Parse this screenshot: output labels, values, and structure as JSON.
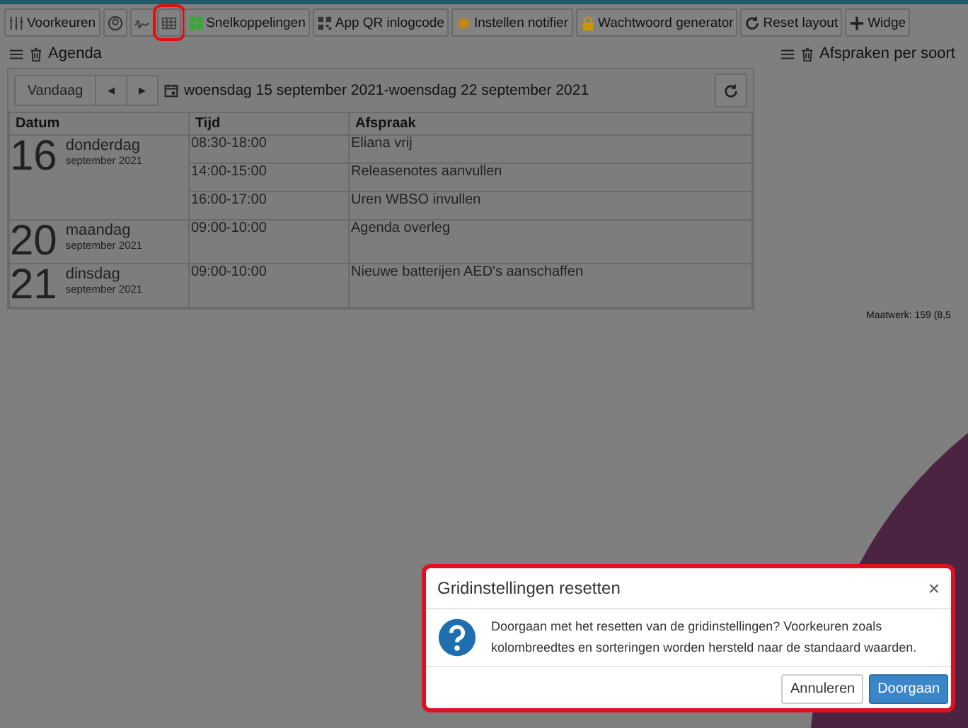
{
  "toolbar": [
    {
      "kind": "sliders",
      "label": "Voorkeuren",
      "highlighted": false
    },
    {
      "kind": "user",
      "highlighted": false
    },
    {
      "kind": "signature",
      "highlighted": false
    },
    {
      "kind": "grid",
      "highlighted": true
    },
    {
      "kind": "tiles",
      "label": "Snelkoppelingen",
      "highlighted": false
    },
    {
      "kind": "qr",
      "label": "App QR inlogcode",
      "highlighted": false
    },
    {
      "kind": "gear",
      "label": "Instellen notifier",
      "highlighted": false
    },
    {
      "kind": "lock",
      "label": "Wachtwoord generator",
      "highlighted": false
    },
    {
      "kind": "refresh",
      "label": "Reset layout",
      "highlighted": false
    },
    {
      "kind": "plus",
      "label": "Widge",
      "highlighted": false
    }
  ],
  "agenda": {
    "title": "Agenda",
    "today_button": "Vandaag",
    "prev": "◂",
    "next": "▸",
    "range": "woensdag 15 september 2021-woensdag 22 september 2021",
    "columns": [
      "Datum",
      "Tijd",
      "Afspraak"
    ],
    "days": [
      {
        "day": "16",
        "weekday": "donderdag",
        "month": "september 2021",
        "items": [
          {
            "time": "08:30-18:00",
            "text": "Eliana vrij"
          },
          {
            "time": "14:00-15:00",
            "text": "Releasenotes aanvullen"
          },
          {
            "time": "16:00-17:00",
            "text": "Uren WBSO invullen"
          }
        ]
      },
      {
        "day": "20",
        "weekday": "maandag",
        "month": "september 2021",
        "items": [
          {
            "time": "09:00-10:00",
            "text": "Agenda overleg"
          }
        ]
      },
      {
        "day": "21",
        "weekday": "dinsdag",
        "month": "september 2021",
        "items": [
          {
            "time": "09:00-10:00",
            "text": "Nieuwe batterijen AED's aanschaffen"
          }
        ]
      }
    ]
  },
  "chart_widget": {
    "title": "Afspraken per soort",
    "slice_label": "Maatwerk: 159   (8,5"
  },
  "dialog": {
    "title": "Gridinstellingen resetten",
    "close": "×",
    "message": "Doorgaan met het resetten van de gridinstellingen? Voorkeuren zoals kolombreedtes en sorteringen worden hersteld naar de standaard waarden.",
    "highlighted": true,
    "buttons": [
      {
        "label": "Annuleren",
        "primary": false
      },
      {
        "label": "Doorgaan",
        "primary": true
      }
    ]
  }
}
